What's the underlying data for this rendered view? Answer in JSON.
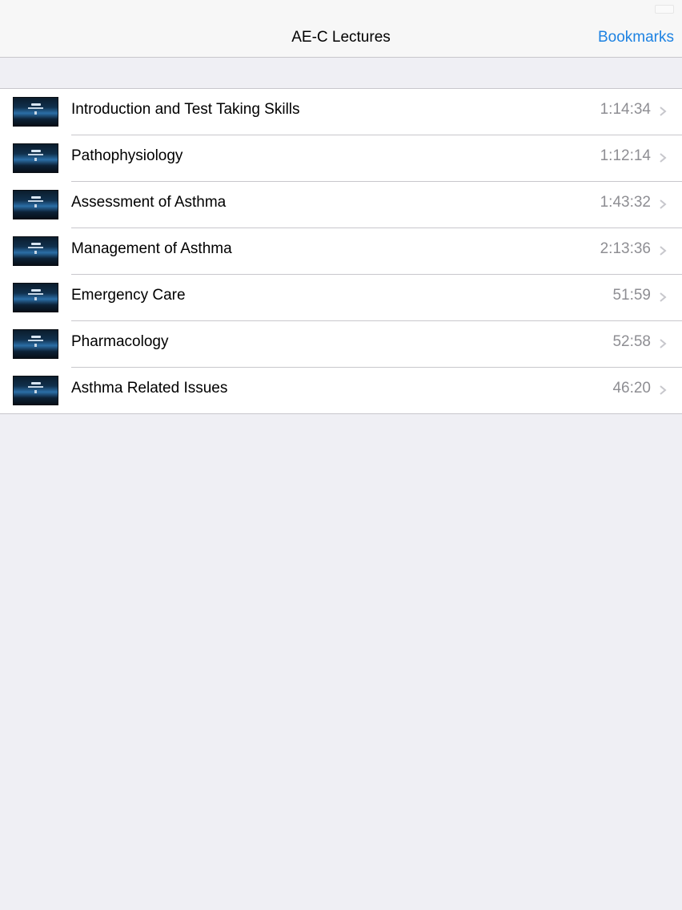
{
  "nav": {
    "title": "AE-C Lectures",
    "right_button": "Bookmarks"
  },
  "colors": {
    "accent": "#1d82e2",
    "background": "#efeff4",
    "secondary_text": "#8e8e93"
  },
  "lectures": [
    {
      "title": "Introduction and Test Taking Skills",
      "duration": "1:14:34"
    },
    {
      "title": "Pathophysiology",
      "duration": "1:12:14"
    },
    {
      "title": "Assessment of Asthma",
      "duration": "1:43:32"
    },
    {
      "title": "Management of Asthma",
      "duration": "2:13:36"
    },
    {
      "title": "Emergency Care",
      "duration": "51:59"
    },
    {
      "title": "Pharmacology",
      "duration": "52:58"
    },
    {
      "title": "Asthma Related Issues",
      "duration": "46:20"
    }
  ],
  "icons": {
    "row_accessory": "chevron-right-icon",
    "row_image": "lecture-thumbnail"
  }
}
